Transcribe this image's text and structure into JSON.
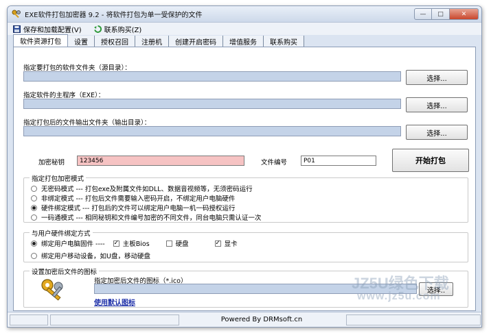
{
  "window": {
    "title": "EXE软件打包加密器 9.2 - 将软件打包为单一受保护的文件",
    "min": "—",
    "max": "□",
    "close": "✕"
  },
  "menu": [
    {
      "label": "保存和加载配置(V)"
    },
    {
      "label": "联系购买(Z)"
    }
  ],
  "tabs": [
    "软件资源打包",
    "设置",
    "授权召回",
    "注册机",
    "创建开启密码",
    "增值服务",
    "联系购买"
  ],
  "paths": {
    "source_label": "指定要打包的软件文件夹（源目录）：",
    "main_label": "指定软件的主程序（EXE）：",
    "output_label": "指定打包后的文件输出文件夹（输出目录）：",
    "browse": "选择..."
  },
  "key": {
    "label": "加密秘钥",
    "value": "123456",
    "fileno_label": "文件编号",
    "fileno_value": "P01",
    "start": "开始打包"
  },
  "mode": {
    "legend": "指定打包加密模式",
    "options": [
      {
        "label": "无密码模式 --- 打包exe及附属文件如DLL、数据音视频等，无须密码运行",
        "checked": false
      },
      {
        "label": "非绑定模式 --- 打包后文件需要输入密码开启，不绑定用户电脑硬件",
        "checked": false
      },
      {
        "label": "硬件绑定模式 --- 打包后的文件可以绑定用户电脑一机一码授权运行",
        "checked": true
      },
      {
        "label": "一码通模式 --- 相同秘钥和文件编号加密的不同文件，同台电脑只需认证一次",
        "checked": false
      }
    ]
  },
  "hw": {
    "legend": "与用户硬件绑定方式",
    "opt1": "绑定用户电脑固件 ----",
    "mb": "主板Bios",
    "disk": "硬盘",
    "gpu": "显卡",
    "opt2": "绑定用户移动设备，如U盘，移动硬盘",
    "check": "✓"
  },
  "icon": {
    "legend": "设置加密后文件的图标",
    "label": "指定加密后文件的图标（*.ico）",
    "browse": "选择..",
    "default_link": "使用默认图标"
  },
  "status": {
    "text": "Powered By DRMsoft.cn"
  },
  "watermark": {
    "line1": "JZ5U绿色下载",
    "line2": "www.jz5u.com"
  }
}
